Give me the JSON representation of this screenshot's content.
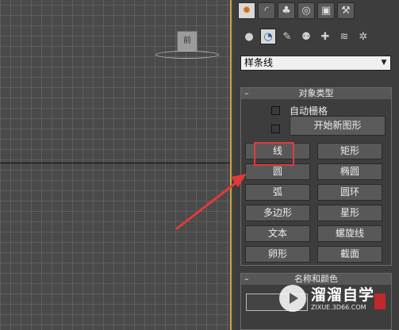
{
  "viewport": {
    "view_label": "前"
  },
  "panel": {
    "main_tabs": [
      {
        "icon": "create-icon",
        "glyph": "✹",
        "active": true
      },
      {
        "icon": "modify-icon",
        "glyph": "◜",
        "active": false
      },
      {
        "icon": "hierarchy-icon",
        "glyph": "♣",
        "active": false
      },
      {
        "icon": "motion-icon",
        "glyph": "◎",
        "active": false
      },
      {
        "icon": "display-icon",
        "glyph": "▣",
        "active": false
      },
      {
        "icon": "utilities-icon",
        "glyph": "⚒",
        "active": false
      }
    ],
    "sub_icons": [
      {
        "icon": "geometry-icon",
        "glyph": "●",
        "active": false
      },
      {
        "icon": "shapes-icon",
        "glyph": "◔",
        "active": true
      },
      {
        "icon": "lights-icon",
        "glyph": "✎",
        "active": false
      },
      {
        "icon": "cameras-icon",
        "glyph": "⚉",
        "active": false
      },
      {
        "icon": "helpers-icon",
        "glyph": "✚",
        "active": false
      },
      {
        "icon": "space-warps-icon",
        "glyph": "≋",
        "active": false
      },
      {
        "icon": "systems-icon",
        "glyph": "✲",
        "active": false
      }
    ],
    "category_value": "样条线",
    "object_type": {
      "toggle": "–",
      "title": "对象类型",
      "auto_grid_label": "自动栅格",
      "start_new_shape_label": "开始新图形",
      "buttons": [
        "线",
        "矩形",
        "圆",
        "椭圆",
        "弧",
        "圆环",
        "多边形",
        "星形",
        "文本",
        "螺旋线",
        "卵形",
        "截面"
      ]
    },
    "name_color": {
      "toggle": "–",
      "title": "名称和颜色"
    }
  },
  "watermark": {
    "title": "溜溜自学",
    "url": "ZIXUE.3D66.COM"
  },
  "colors": {
    "highlight": "#e23a3a",
    "viewport_border": "#c9a33a",
    "swatch": "#c0282d"
  }
}
